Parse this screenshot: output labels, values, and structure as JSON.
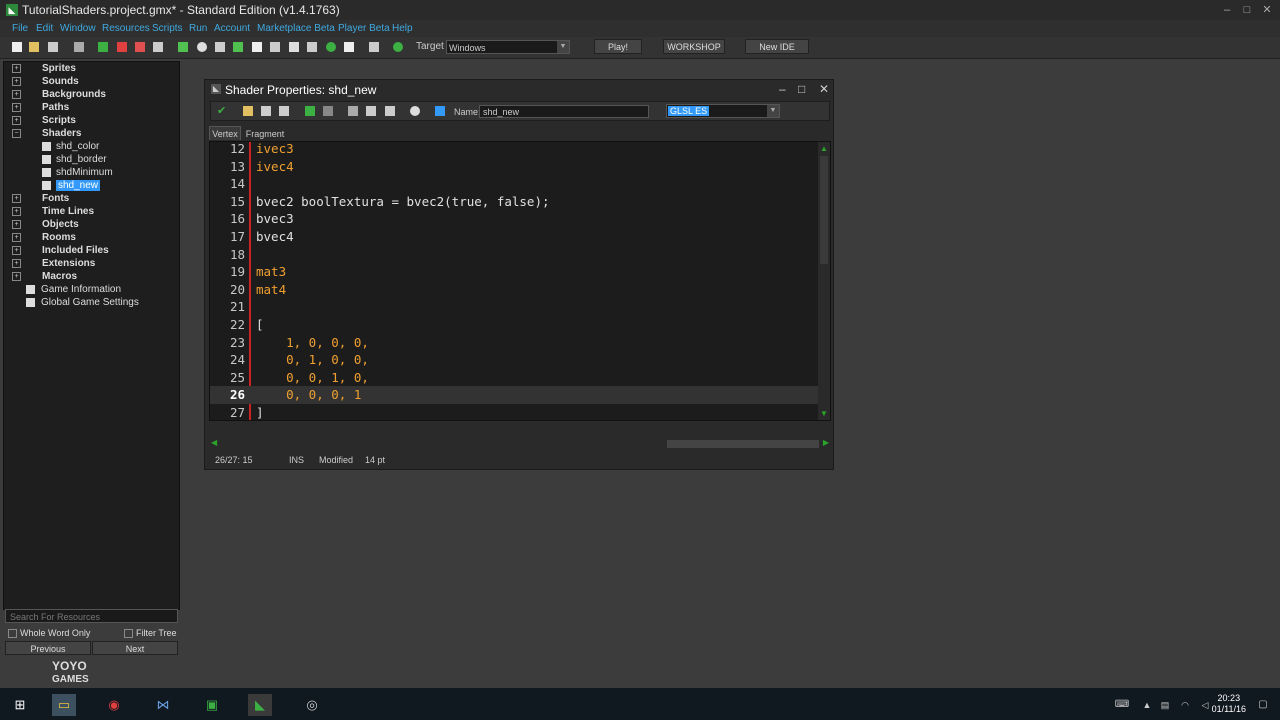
{
  "window": {
    "title": "TutorialShaders.project.gmx* - Standard Edition (v1.4.1763)",
    "app_icon": "gamemaker-icon"
  },
  "menu": [
    "File",
    "Edit",
    "Window",
    "Resources",
    "Scripts",
    "Run",
    "Account",
    "Marketplace Beta",
    "Player Beta",
    "Help"
  ],
  "toolbar": {
    "target_label": "Target",
    "target_value": "Windows",
    "play_label": "Play!",
    "workshop_label": "WORKSHOP",
    "newide_label": "New IDE"
  },
  "tree": {
    "sprites": "Sprites",
    "sounds": "Sounds",
    "backgrounds": "Backgrounds",
    "paths": "Paths",
    "scripts": "Scripts",
    "shaders": "Shaders",
    "shader_children": [
      "shd_color",
      "shd_border",
      "shdMinimum",
      "shd_new"
    ],
    "fonts": "Fonts",
    "timelines": "Time Lines",
    "objects": "Objects",
    "rooms": "Rooms",
    "included": "Included Files",
    "extensions": "Extensions",
    "macros": "Macros",
    "gameinfo": "Game Information",
    "globalsettings": "Global Game Settings"
  },
  "search": {
    "placeholder": "Search For Resources",
    "whole_word": "Whole Word Only",
    "filter_tree": "Filter Tree",
    "previous": "Previous",
    "next": "Next"
  },
  "logo": {
    "line1": "YOYO",
    "line2": "GAMES"
  },
  "shader_window": {
    "title": "Shader Properties: shd_new",
    "name_label": "Name:",
    "name_value": "shd_new",
    "language": "GLSL ES",
    "tabs": [
      "Vertex",
      "Fragment"
    ],
    "lines": [
      {
        "n": "12",
        "code": "ivec3",
        "keyword": true
      },
      {
        "n": "13",
        "code": "ivec4",
        "keyword": true
      },
      {
        "n": "14",
        "code": "",
        "keyword": false
      },
      {
        "n": "15",
        "code": "bvec2 boolTextura = bvec2(true, false);",
        "keyword": false
      },
      {
        "n": "16",
        "code": "bvec3",
        "keyword": false
      },
      {
        "n": "17",
        "code": "bvec4",
        "keyword": false
      },
      {
        "n": "18",
        "code": "",
        "keyword": false
      },
      {
        "n": "19",
        "code": "mat3",
        "keyword": true
      },
      {
        "n": "20",
        "code": "mat4",
        "keyword": true
      },
      {
        "n": "21",
        "code": "",
        "keyword": false
      },
      {
        "n": "22",
        "code": "[",
        "keyword": false
      },
      {
        "n": "23",
        "code": "    1, 0, 0, 0,",
        "keyword": true
      },
      {
        "n": "24",
        "code": "    0, 1, 0, 0,",
        "keyword": true
      },
      {
        "n": "25",
        "code": "    0, 0, 1, 0,",
        "keyword": true
      },
      {
        "n": "26",
        "code": "    0, 0, 0, 1",
        "keyword": true,
        "current": true
      },
      {
        "n": "27",
        "code": "]",
        "keyword": false
      }
    ],
    "status": {
      "position": "26/27: 15",
      "mode": "INS",
      "state": "Modified",
      "font_size": "14 pt"
    }
  },
  "taskbar": {
    "time": "20:23",
    "date": "01/11/16",
    "apps": [
      "windows-start-icon",
      "file-explorer-icon",
      "chrome-icon",
      "visual-studio-icon",
      "gamemaker-ide-icon",
      "gamemaker-icon",
      "obs-icon"
    ]
  },
  "colors": {
    "keyword": "#f0a030",
    "menu_text": "#3fa9e0",
    "selection": "#3399ff",
    "gutter_line": "#cc2222"
  }
}
